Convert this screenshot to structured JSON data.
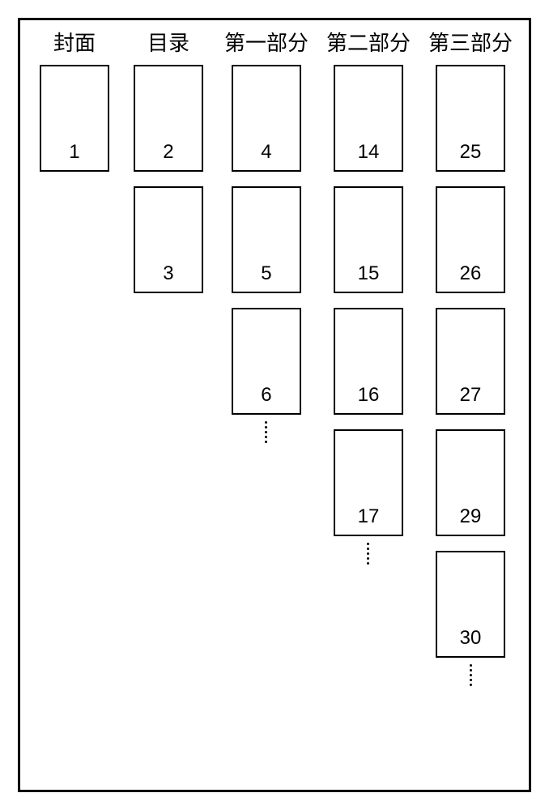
{
  "columns": [
    {
      "header": "封面",
      "items": [
        {
          "type": "box",
          "number": "1"
        }
      ]
    },
    {
      "header": "目录",
      "items": [
        {
          "type": "box",
          "number": "2"
        },
        {
          "type": "box",
          "number": "3"
        }
      ]
    },
    {
      "header": "第一部分",
      "items": [
        {
          "type": "box",
          "number": "4"
        },
        {
          "type": "box",
          "number": "5"
        },
        {
          "type": "box",
          "number": "6"
        },
        {
          "type": "ellipsis"
        }
      ]
    },
    {
      "header": "第二部分",
      "items": [
        {
          "type": "box",
          "number": "14"
        },
        {
          "type": "box",
          "number": "15"
        },
        {
          "type": "box",
          "number": "16"
        },
        {
          "type": "box",
          "number": "17"
        },
        {
          "type": "ellipsis"
        }
      ]
    },
    {
      "header": "第三部分",
      "items": [
        {
          "type": "box",
          "number": "25"
        },
        {
          "type": "box",
          "number": "26"
        },
        {
          "type": "box",
          "number": "27"
        },
        {
          "type": "box",
          "number": "29"
        },
        {
          "type": "box",
          "number": "30"
        },
        {
          "type": "ellipsis"
        }
      ]
    }
  ]
}
